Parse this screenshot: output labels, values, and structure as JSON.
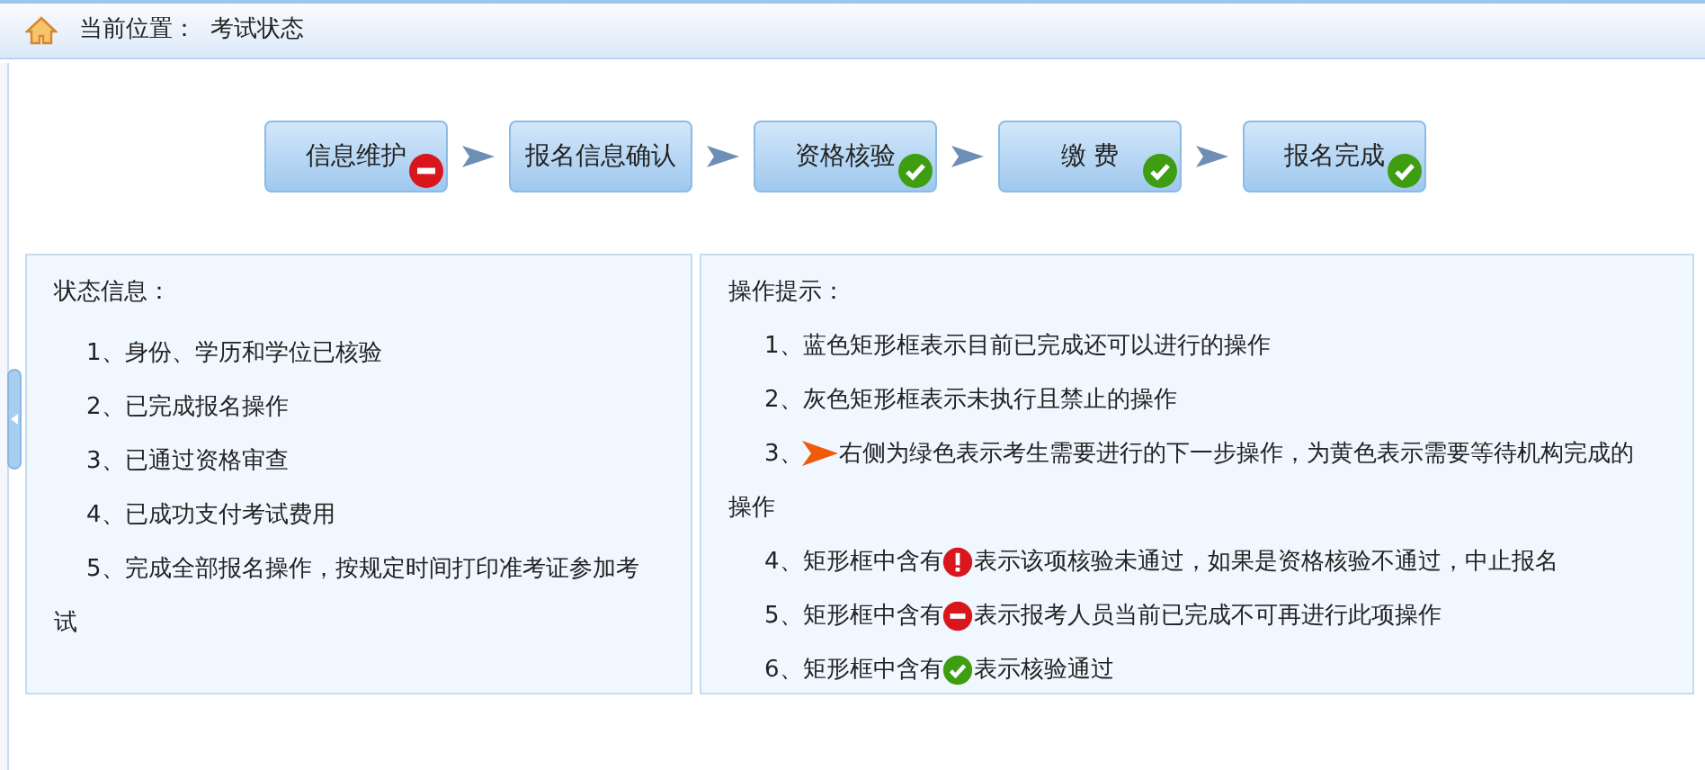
{
  "breadcrumb": {
    "label": "当前位置：",
    "current": "考试状态"
  },
  "steps": [
    {
      "label": "信息维护",
      "kind": "blocked"
    },
    {
      "label": "报名信息确认",
      "kind": "plain"
    },
    {
      "label": "资格核验",
      "kind": "passed"
    },
    {
      "label": "缴 费",
      "kind": "passed"
    },
    {
      "label": "报名完成",
      "kind": "passed"
    }
  ],
  "status_panel": {
    "title": "状态信息：",
    "items": [
      "1、身份、学历和学位已核验",
      "2、已完成报名操作",
      "3、已通过资格审查",
      "4、已成功支付考试费用",
      "5、完成全部报名操作，按规定时间打印准考证参加考试"
    ]
  },
  "hints_panel": {
    "title": "操作提示：",
    "items": [
      {
        "kind": "plain",
        "before": "1、蓝色矩形框表示目前已完成还可以进行的操作"
      },
      {
        "kind": "plain",
        "before": "2、灰色矩形框表示未执行且禁止的操作"
      },
      {
        "kind": "arrow",
        "before": "3、",
        "after": "右侧为绿色表示考生需要进行的下一步操作，为黄色表示需要等待机构完成的",
        "continued": "操作"
      },
      {
        "kind": "error",
        "before": "4、矩形框中含有",
        "after": "表示该项核验未通过，如果是资格核验不通过，中止报名"
      },
      {
        "kind": "blocked",
        "before": "5、矩形框中含有",
        "after": "表示报考人员当前已完成不可再进行此项操作"
      },
      {
        "kind": "passed",
        "before": "6、矩形框中含有",
        "after": "表示核验通过"
      }
    ]
  }
}
